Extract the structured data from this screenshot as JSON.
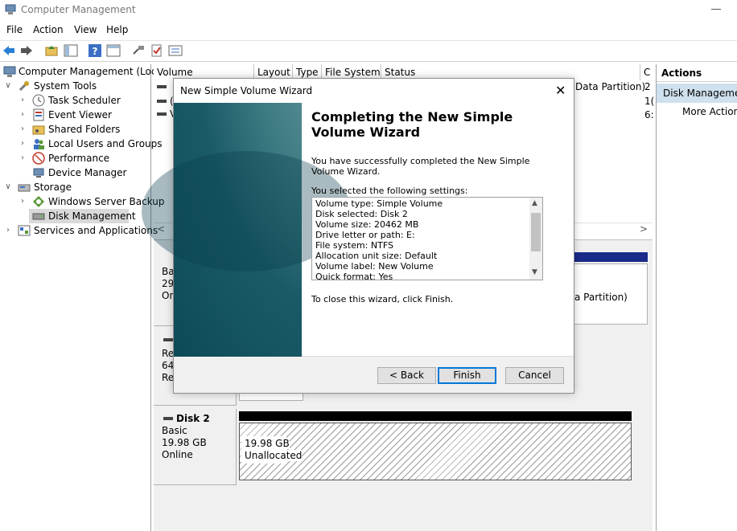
{
  "window": {
    "title": "Computer Management"
  },
  "menu": [
    "File",
    "Action",
    "View",
    "Help"
  ],
  "toolbar_icons": [
    "back-arrow-icon",
    "forward-arrow-icon",
    "folder-up-icon",
    "console-tree-icon",
    "help-icon",
    "properties-icon",
    "connect-icon",
    "check-icon",
    "list-icon"
  ],
  "tree": {
    "root": "Computer Management (Local",
    "system_tools": "System Tools",
    "task_scheduler": "Task Scheduler",
    "event_viewer": "Event Viewer",
    "shared_folders": "Shared Folders",
    "local_users": "Local Users and Groups",
    "performance": "Performance",
    "device_manager": "Device Manager",
    "storage": "Storage",
    "backup": "Windows Server Backup",
    "disk_management": "Disk Management",
    "services": "Services and Applications"
  },
  "list": {
    "columns": [
      "Volume",
      "Layout",
      "Type",
      "File System",
      "Status",
      "C"
    ],
    "row_fragments": {
      "r1_partition": "Data Partition)",
      "r1_cap": "2",
      "r2_cap": "1(",
      "r3_cap": "6:",
      "r2_vol": "(",
      "r3_vol": "V"
    }
  },
  "disks": {
    "d0": {
      "l1": "Basi",
      "l2": "29.",
      "l3": "Onl",
      "part_status": "a Partition)"
    },
    "d1": {
      "l1": "Re",
      "l2": "64",
      "l3": "Re"
    },
    "d2": {
      "name": "Disk 2",
      "type": "Basic",
      "size": "19.98 GB",
      "status": "Online",
      "part_size": "19.98 GB",
      "part_label": "Unallocated"
    }
  },
  "actions": {
    "header": "Actions",
    "section": "Disk Management",
    "more": "More Actions"
  },
  "wizard": {
    "title": "New Simple Volume Wizard",
    "heading": "Completing the New Simple Volume Wizard",
    "success": "You have successfully completed the New Simple Volume Wizard.",
    "selected": "You selected the following settings:",
    "settings": [
      "Volume type: Simple Volume",
      "Disk selected: Disk 2",
      "Volume size: 20462 MB",
      "Drive letter or path: E:",
      "File system: NTFS",
      "Allocation unit size: Default",
      "Volume label: New Volume",
      "Quick format: Yes"
    ],
    "close_text": "To close this wizard, click Finish.",
    "back": "< Back",
    "finish": "Finish",
    "cancel": "Cancel"
  }
}
